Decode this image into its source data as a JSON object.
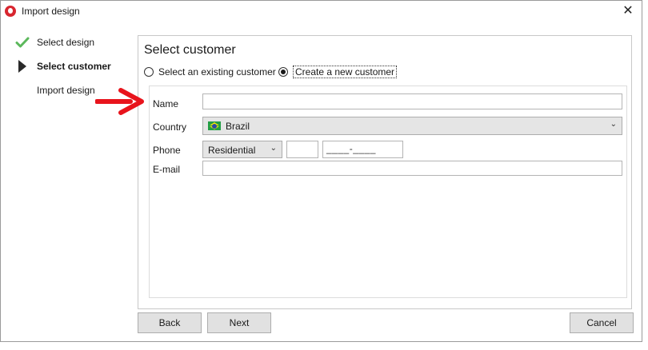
{
  "window": {
    "title": "Import design",
    "close_glyph": "✕"
  },
  "wizard_steps": [
    {
      "label": "Select design",
      "state": "done",
      "icon": "checkmark-icon"
    },
    {
      "label": "Select customer",
      "state": "current",
      "icon": "current-step-arrow-icon"
    },
    {
      "label": "Import design",
      "state": "pending",
      "icon": ""
    }
  ],
  "panel": {
    "title": "Select customer",
    "radios": [
      {
        "label": "Select an existing customer",
        "checked": false
      },
      {
        "label": "Create a new customer",
        "checked": true
      }
    ],
    "form": {
      "name_label": "Name",
      "name_value": "",
      "country_label": "Country",
      "country_value": "Brazil",
      "country_flag": "brazil-flag-icon",
      "phone_label": "Phone",
      "phone_type": "Residential",
      "phone_area_code": "",
      "phone_mask": "____-____",
      "email_label": "E-mail",
      "email_value": ""
    }
  },
  "buttons": {
    "back": "Back",
    "next": "Next",
    "cancel": "Cancel"
  },
  "colors": {
    "check_green": "#5cb85c",
    "annotation_red": "#e8141c",
    "app_icon_red": "#d8262f"
  }
}
